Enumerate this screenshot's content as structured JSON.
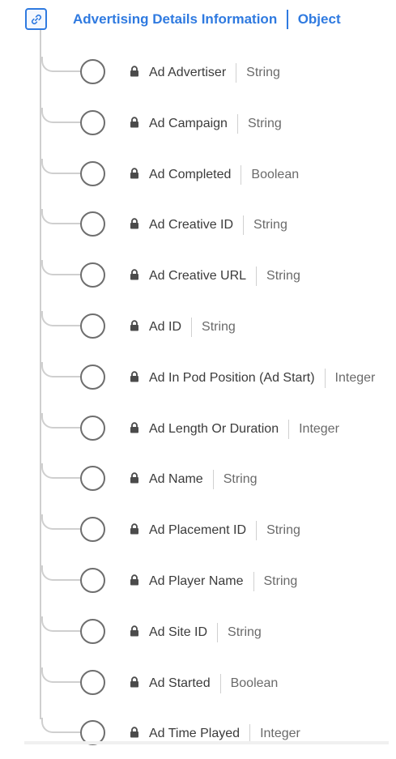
{
  "root": {
    "title": "Advertising Details Information",
    "type": "Object",
    "icon": "link-icon",
    "accent_color": "#2f7ae0"
  },
  "fields": [
    {
      "name": "Ad Advertiser",
      "type": "String",
      "locked": true
    },
    {
      "name": "Ad Campaign",
      "type": "String",
      "locked": true
    },
    {
      "name": "Ad Completed",
      "type": "Boolean",
      "locked": true
    },
    {
      "name": "Ad Creative ID",
      "type": "String",
      "locked": true
    },
    {
      "name": "Ad Creative URL",
      "type": "String",
      "locked": true
    },
    {
      "name": "Ad ID",
      "type": "String",
      "locked": true
    },
    {
      "name": "Ad In Pod Position (Ad Start)",
      "type": "Integer",
      "locked": true
    },
    {
      "name": "Ad Length Or Duration",
      "type": "Integer",
      "locked": true
    },
    {
      "name": "Ad Name",
      "type": "String",
      "locked": true
    },
    {
      "name": "Ad Placement ID",
      "type": "String",
      "locked": true
    },
    {
      "name": "Ad Player Name",
      "type": "String",
      "locked": true
    },
    {
      "name": "Ad Site ID",
      "type": "String",
      "locked": true
    },
    {
      "name": "Ad Started",
      "type": "Boolean",
      "locked": true
    },
    {
      "name": "Ad Time Played",
      "type": "Integer",
      "locked": true
    }
  ]
}
